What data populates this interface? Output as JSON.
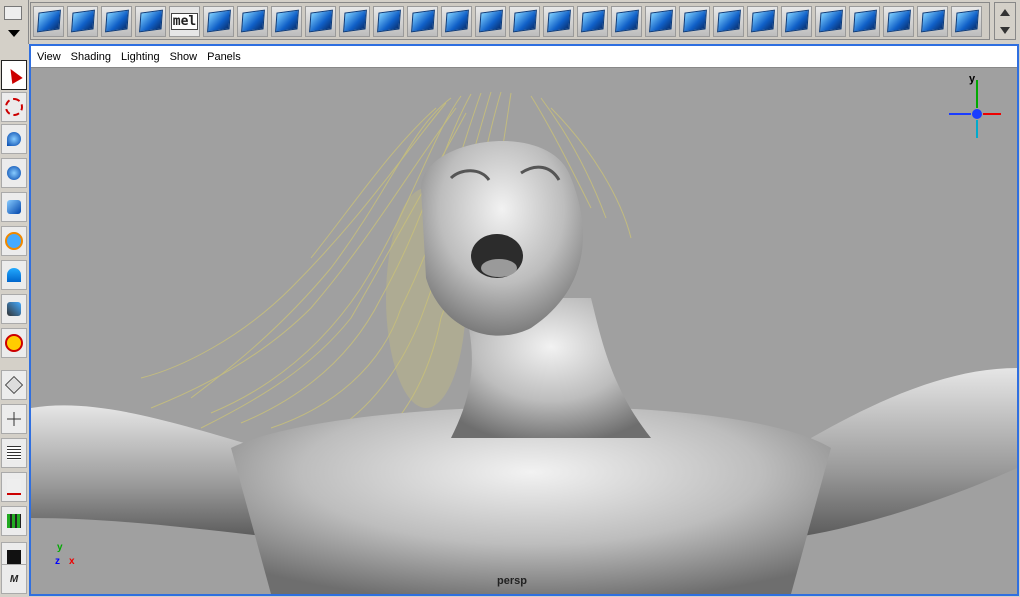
{
  "shelf": {
    "icons": [
      {
        "name": "poly-sphere-icon"
      },
      {
        "name": "poly-cube-icon"
      },
      {
        "name": "poly-cylinder-icon"
      },
      {
        "name": "poly-cone-icon"
      },
      {
        "name": "mel-icon",
        "label": "mel"
      },
      {
        "name": "poly-plane-icon"
      },
      {
        "name": "poly-torus-icon"
      },
      {
        "name": "poly-pipe-icon"
      },
      {
        "name": "combine-icon"
      },
      {
        "name": "separate-icon"
      },
      {
        "name": "boolean-icon"
      },
      {
        "name": "smooth-icon"
      },
      {
        "name": "extrude-face-icon"
      },
      {
        "name": "extrude-edge-icon"
      },
      {
        "name": "split-polygon-icon"
      },
      {
        "name": "bevel-icon"
      },
      {
        "name": "append-polygon-icon"
      },
      {
        "name": "wedge-face-icon"
      },
      {
        "name": "cut-faces-icon"
      },
      {
        "name": "merge-vertices-icon"
      },
      {
        "name": "subdivide-icon"
      },
      {
        "name": "extract-icon"
      },
      {
        "name": "duplicate-face-icon"
      },
      {
        "name": "mirror-icon"
      },
      {
        "name": "planar-mapping-icon"
      },
      {
        "name": "cylindrical-mapping-icon"
      },
      {
        "name": "spherical-mapping-icon"
      },
      {
        "name": "automatic-mapping-icon"
      }
    ]
  },
  "panel": {
    "menus": [
      "View",
      "Shading",
      "Lighting",
      "Show",
      "Panels"
    ],
    "camera": "persp"
  },
  "axes": {
    "y": "y",
    "z": "z",
    "x": "x"
  },
  "viewcube": {
    "y": "y"
  },
  "colors": {
    "viewport_bg": "#a0a0a0",
    "active_border": "#2f6fe0",
    "hair": "#c8c07a",
    "skin": "#c9c9c9"
  }
}
